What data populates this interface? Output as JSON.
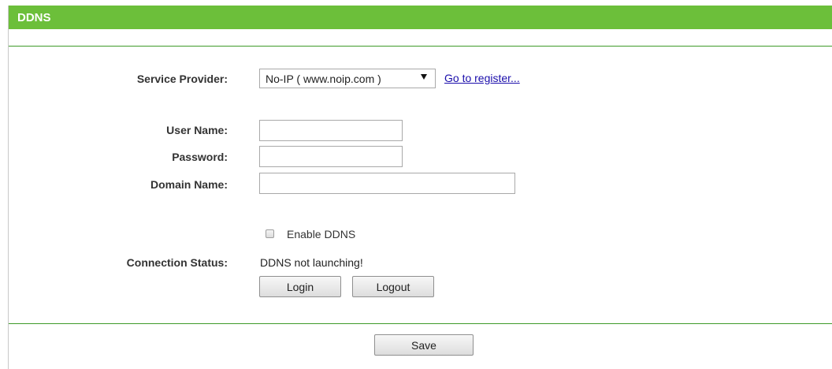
{
  "header": {
    "title": "DDNS"
  },
  "form": {
    "service_provider": {
      "label": "Service Provider:",
      "selected": "No-IP ( www.noip.com )",
      "register_link": "Go to register..."
    },
    "username": {
      "label": "User Name:",
      "value": ""
    },
    "password": {
      "label": "Password:",
      "value": ""
    },
    "domain": {
      "label": "Domain Name:",
      "value": ""
    },
    "enable_ddns": {
      "label": "Enable DDNS",
      "checked": false
    },
    "connection_status": {
      "label": "Connection Status:",
      "value": "DDNS not launching!"
    },
    "login_label": "Login",
    "logout_label": "Logout"
  },
  "footer": {
    "save_label": "Save"
  },
  "colors": {
    "header_bg": "#6cbf3a",
    "rule": "#3e9a2a",
    "link": "#1a0dab"
  }
}
